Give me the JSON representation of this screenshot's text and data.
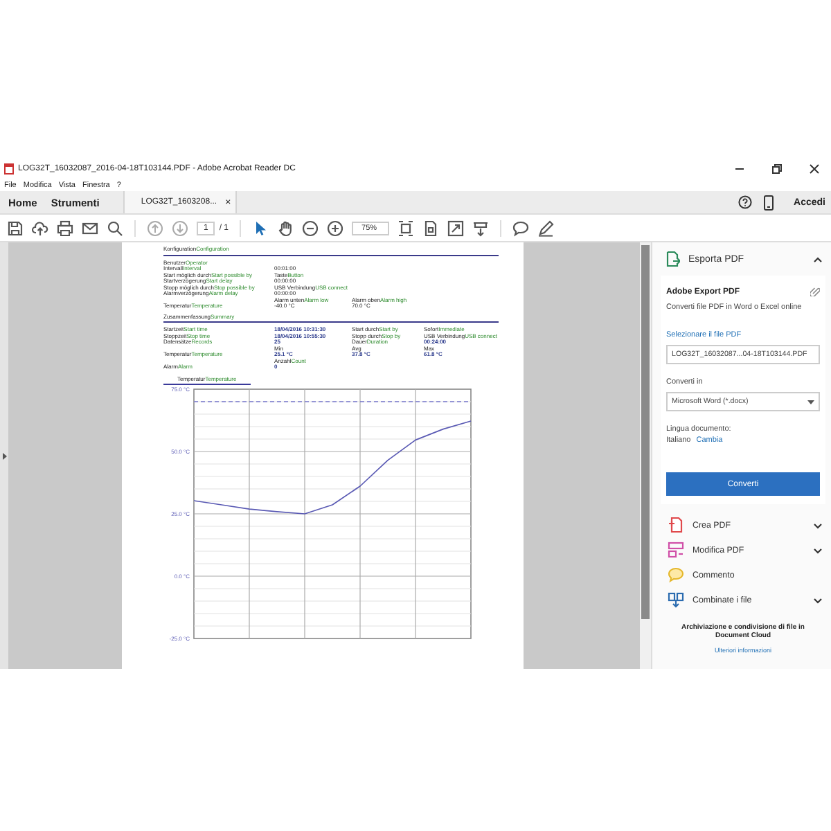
{
  "window": {
    "title": "LOG32T_16032087_2016-04-18T103144.PDF - Adobe Acrobat Reader DC"
  },
  "menu": [
    "File",
    "Modifica",
    "Vista",
    "Finestra",
    "?"
  ],
  "nav": [
    "Home",
    "Strumenti"
  ],
  "tabs": [
    {
      "label": "LOG32T_1603208...",
      "close": "×",
      "selected": true
    }
  ],
  "account": {
    "label": "Accedi"
  },
  "toolbar": {
    "page": "1",
    "pages": "/ 1",
    "zoom": "75%"
  },
  "document": {
    "sections": [
      {
        "title": {
          "de": "Konfiguration",
          "en": "Configuration"
        },
        "rows": [
          {
            "cells": [
              {
                "kind": "label",
                "de": "Benutzer",
                "en": "Operator"
              }
            ]
          },
          {
            "cells": [
              {
                "kind": "label",
                "de": "Intervall",
                "en": "Interval"
              },
              {
                "kind": "value",
                "text": "00:01:00",
                "strong": false
              }
            ]
          },
          {
            "cells": [
              {
                "kind": "label",
                "de": "Start möglich durch",
                "en": "Start possible by"
              },
              {
                "kind": "label",
                "de": "Taste",
                "en": "Button"
              }
            ]
          },
          {
            "cells": [
              {
                "kind": "label",
                "de": "Startverzögerung",
                "en": "Start delay"
              },
              {
                "kind": "value",
                "text": "00:00:00",
                "strong": false
              }
            ]
          },
          {
            "cells": [
              {
                "kind": "label",
                "de": "Stopp möglich durch",
                "en": "Stop possible by"
              },
              {
                "kind": "label",
                "de": "USB Verbindung",
                "en": "USB connect"
              }
            ]
          },
          {
            "cells": [
              {
                "kind": "label",
                "de": "Alarmverzögerung",
                "en": "Alarm delay"
              },
              {
                "kind": "value",
                "text": "00:00:00",
                "strong": false
              }
            ]
          },
          {
            "cells": [
              {
                "kind": "blank"
              },
              {
                "kind": "label",
                "de": "Alarm unten",
                "en": "Alarm low"
              },
              {
                "kind": "label",
                "de": "Alarm oben",
                "en": "Alarm high"
              }
            ]
          },
          {
            "cells": [
              {
                "kind": "label",
                "de": "Temperatur",
                "en": "Temperature"
              },
              {
                "kind": "value",
                "text": "-40.0 °C",
                "strong": false
              },
              {
                "kind": "value",
                "text": "70.0 °C",
                "strong": false
              }
            ]
          }
        ]
      },
      {
        "title": {
          "de": "Zusammenfassung",
          "en": "Summary"
        },
        "rows": [
          {
            "cells": [
              {
                "kind": "label",
                "de": "Startzeit",
                "en": "Start time"
              },
              {
                "kind": "value",
                "text": "18/04/2016 10:31:30",
                "strong": true
              },
              {
                "kind": "label",
                "de": "Start durch",
                "en": "Start by"
              },
              {
                "kind": "label",
                "de": "Sofort",
                "en": "Immediate"
              }
            ]
          },
          {
            "cells": [
              {
                "kind": "label",
                "de": "Stoppzeit",
                "en": "Stop time"
              },
              {
                "kind": "value",
                "text": "18/04/2016 10:55:30",
                "strong": true
              },
              {
                "kind": "label",
                "de": "Stopp durch",
                "en": "Stop by"
              },
              {
                "kind": "label",
                "de": "USB Verbindung",
                "en": "USB connect"
              }
            ]
          },
          {
            "cells": [
              {
                "kind": "label",
                "de": "Datensätze",
                "en": "Records"
              },
              {
                "kind": "value",
                "text": "25",
                "strong": true
              },
              {
                "kind": "label",
                "de": "Dauer",
                "en": "Duration"
              },
              {
                "kind": "value",
                "text": "00:24:00",
                "strong": true
              }
            ]
          },
          {
            "cells": [
              {
                "kind": "blank"
              },
              {
                "kind": "value",
                "text": "Min",
                "strong": false
              },
              {
                "kind": "value",
                "text": "Avg",
                "strong": false
              },
              {
                "kind": "value",
                "text": "Max",
                "strong": false
              }
            ]
          },
          {
            "cells": [
              {
                "kind": "label",
                "de": "Temperatur",
                "en": "Temperature"
              },
              {
                "kind": "value",
                "text": "25.1 °C",
                "strong": true
              },
              {
                "kind": "value",
                "text": "37.8 °C",
                "strong": true
              },
              {
                "kind": "value",
                "text": "61.8 °C",
                "strong": true
              }
            ]
          },
          {
            "cells": [
              {
                "kind": "blank"
              },
              {
                "kind": "label",
                "de": "Anzahl",
                "en": "Count"
              }
            ]
          },
          {
            "cells": [
              {
                "kind": "label",
                "de": "Alarm",
                "en": "Alarm"
              },
              {
                "kind": "value",
                "text": "0",
                "strong": true
              }
            ]
          }
        ]
      }
    ],
    "chart_tab": {
      "de": "Temperatur",
      "en": "Temperature"
    },
    "chart_data": {
      "type": "line",
      "ylim": [
        -25,
        75
      ],
      "yticks": [
        {
          "value": 75,
          "label": "75.0 °C"
        },
        {
          "value": 50,
          "label": "50.0 °C"
        },
        {
          "value": 25,
          "label": "25.0 °C"
        },
        {
          "value": 0,
          "label": "0.0 °C"
        },
        {
          "value": -25,
          "label": "-25.0 °C"
        }
      ],
      "categories": [
        null,
        null,
        null,
        null,
        null,
        null,
        null,
        null,
        null,
        null,
        null
      ],
      "series": [
        {
          "color": "#5a5ab4",
          "line_style": "solid",
          "values": [
            30.3,
            28.6,
            26.9,
            25.9,
            25.0,
            28.6,
            36.1,
            46.5,
            54.6,
            59.0,
            62.2
          ]
        },
        {
          "color": "#7777cc",
          "line_style": "dashed",
          "values": [
            70,
            70,
            70,
            70,
            70,
            70,
            70,
            70,
            70,
            70,
            70
          ]
        }
      ],
      "grid": true
    }
  },
  "panel": {
    "header": "Esporta PDF",
    "expanded": true,
    "title": "Adobe Export PDF",
    "description": "Converti file PDF in Word o Excel online",
    "select_label": "Selezionare il file PDF",
    "file": "LOG32T_16032087...04-18T103144.PDF",
    "convert_label": "Converti in",
    "format": "Microsoft Word (*.docx)",
    "language_label": "Lingua documento:",
    "language": "Italiano",
    "change": "Cambia",
    "button": "Converti",
    "tools": [
      {
        "label": "Crea PDF",
        "kind": "create",
        "expandable": true
      },
      {
        "label": "Modifica PDF",
        "kind": "edit",
        "expandable": true
      },
      {
        "label": "Commento",
        "kind": "comment",
        "expandable": false
      },
      {
        "label": "Combinate i file",
        "kind": "combine",
        "expandable": true
      }
    ],
    "footer": "Archiviazione e condivisione di file in Document Cloud",
    "link": "Ulteriori informazioni"
  }
}
